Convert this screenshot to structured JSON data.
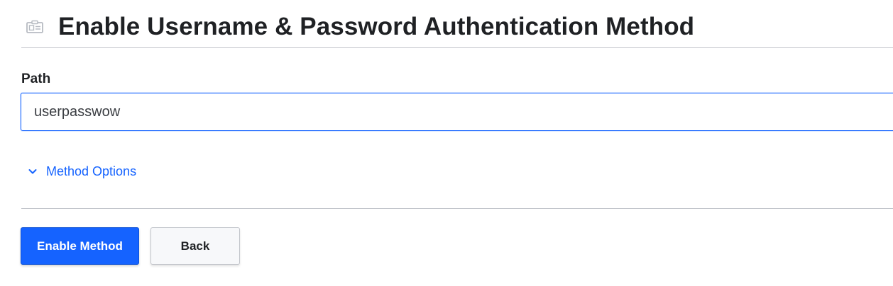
{
  "page": {
    "title": "Enable Username & Password Authentication Method",
    "icon": "id-card-icon"
  },
  "form": {
    "path_label": "Path",
    "path_value": "userpasswow",
    "method_options_label": "Method Options",
    "method_options_icon": "chevron-down-icon"
  },
  "actions": {
    "enable_label": "Enable Method",
    "back_label": "Back"
  },
  "colors": {
    "accent": "#1563ff",
    "text": "#1f2124",
    "divider": "#c2c5cb",
    "secondary_button_bg": "#f7f8fa"
  }
}
